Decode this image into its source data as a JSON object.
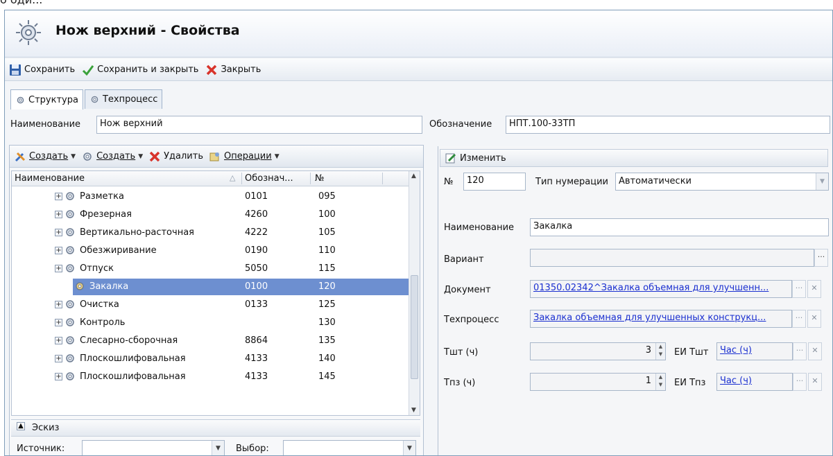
{
  "window": {
    "title": "Нож верхний - Свойства"
  },
  "toolbar": {
    "save_label": "Сохранить",
    "save_close_label": "Сохранить и закрыть",
    "close_label": "Закрыть"
  },
  "tabs": [
    {
      "label": "Структура",
      "active": true
    },
    {
      "label": "Техпроцесс",
      "active": false
    }
  ],
  "header_fields": {
    "name_label": "Наименование",
    "name_value": "Нож верхний",
    "designation_label": "Обозначение",
    "designation_value": "НПТ.100-33ТП"
  },
  "left_toolbar": {
    "create1_label": "Создать",
    "create2_label": "Создать",
    "delete_label": "Удалить",
    "operations_label": "Операции"
  },
  "grid": {
    "columns": [
      "Наименование",
      "Обознач...",
      "№"
    ],
    "rows": [
      {
        "name": "Разметка",
        "code": "0101",
        "num": "095",
        "selected": false
      },
      {
        "name": "Фрезерная",
        "code": "4260",
        "num": "100",
        "selected": false
      },
      {
        "name": "Вертикально-расточная",
        "code": "4222",
        "num": "105",
        "selected": false
      },
      {
        "name": "Обезжиривание",
        "code": "0190",
        "num": "110",
        "selected": false
      },
      {
        "name": "Отпуск",
        "code": "5050",
        "num": "115",
        "selected": false
      },
      {
        "name": "Закалка",
        "code": "0100",
        "num": "120",
        "selected": true
      },
      {
        "name": "Очистка",
        "code": "0133",
        "num": "125",
        "selected": false
      },
      {
        "name": "Контроль",
        "code": "",
        "num": "130",
        "selected": false
      },
      {
        "name": "Слесарно-сборочная",
        "code": "8864",
        "num": "135",
        "selected": false
      },
      {
        "name": "Плоскошлифовальная",
        "code": "4133",
        "num": "140",
        "selected": false
      },
      {
        "name": "Плоскошлифовальная",
        "code": "4133",
        "num": "145",
        "selected": false
      }
    ]
  },
  "sketch": {
    "title": "Эскиз",
    "source_label": "Источник:",
    "source_value": "",
    "choice_label": "Выбор:",
    "choice_value": ""
  },
  "right_panel": {
    "edit_label": "Изменить",
    "number_label": "№",
    "number_value": "120",
    "numbering_type_label": "Тип нумерации",
    "numbering_type_value": "Автоматически",
    "name_label": "Наименование",
    "name_value": "Закалка",
    "variant_label": "Вариант",
    "variant_value": "",
    "document_label": "Документ",
    "document_value": "01350.02342^Закалка объемная для улучшенн...",
    "techprocess_label": "Техпроцесс",
    "techprocess_value": "Закалка объемная для улучшенных конструкц...",
    "tsht_label": "Тшт (ч)",
    "tsht_value": "3",
    "ei_tsht_label": "ЕИ Тшт",
    "ei_tsht_value": "Час (ч)",
    "tpz_label": "Тпз (ч)",
    "tpz_value": "1",
    "ei_tpz_label": "ЕИ Тпз",
    "ei_tpz_value": "Час (ч)"
  },
  "icons": {
    "gear": "gear-icon",
    "save": "floppy-disk-icon",
    "check": "checkmark-icon",
    "close": "red-x-icon",
    "edit": "pencil-edit-icon"
  },
  "colors": {
    "selection": "#6d8fd0",
    "link": "#1a2fd0",
    "border": "#7f9db9"
  }
}
